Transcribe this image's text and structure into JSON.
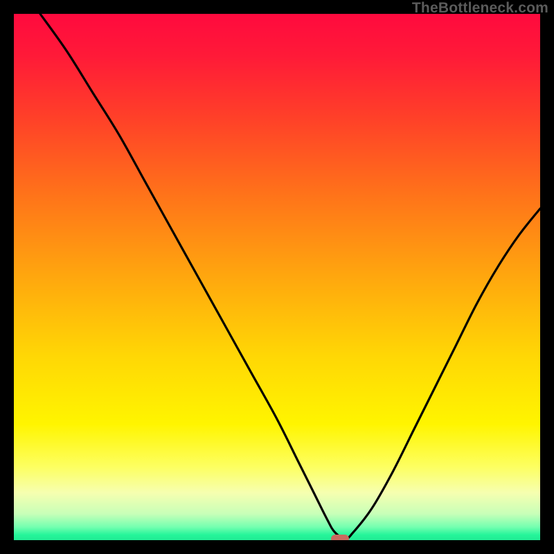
{
  "watermark": {
    "text": "TheBottleneck.com"
  },
  "colors": {
    "frame_bg": "#000000",
    "gradient_stops": [
      {
        "offset": 0.0,
        "color": "#ff0a3e"
      },
      {
        "offset": 0.08,
        "color": "#ff1a38"
      },
      {
        "offset": 0.2,
        "color": "#ff4128"
      },
      {
        "offset": 0.35,
        "color": "#ff7519"
      },
      {
        "offset": 0.5,
        "color": "#ffa70e"
      },
      {
        "offset": 0.65,
        "color": "#ffd705"
      },
      {
        "offset": 0.78,
        "color": "#fff500"
      },
      {
        "offset": 0.86,
        "color": "#fdff60"
      },
      {
        "offset": 0.91,
        "color": "#f6ffb0"
      },
      {
        "offset": 0.95,
        "color": "#c8ffb8"
      },
      {
        "offset": 0.975,
        "color": "#74ffb0"
      },
      {
        "offset": 0.99,
        "color": "#25f59a"
      },
      {
        "offset": 1.0,
        "color": "#21eb94"
      }
    ],
    "curve_stroke": "#000000",
    "marker_fill": "#c96a5f"
  },
  "chart_data": {
    "type": "line",
    "title": "",
    "xlabel": "",
    "ylabel": "",
    "xlim": [
      0,
      100
    ],
    "ylim": [
      0,
      100
    ],
    "grid": false,
    "legend": false,
    "series": [
      {
        "name": "bottleneck-curve",
        "x": [
          5,
          10,
          15,
          20,
          25,
          30,
          35,
          40,
          45,
          50,
          54,
          57,
          59.5,
          61,
          63,
          64.5,
          68,
          72,
          76,
          80,
          84,
          88,
          92,
          96,
          100
        ],
        "y": [
          100,
          93,
          85,
          77,
          68,
          59,
          50,
          41,
          32,
          23,
          15,
          9,
          4,
          1.5,
          0.3,
          1.5,
          6,
          13,
          21,
          29,
          37,
          45,
          52,
          58,
          63
        ]
      }
    ],
    "marker": {
      "x": 62,
      "y": 0.3
    },
    "annotations": []
  }
}
